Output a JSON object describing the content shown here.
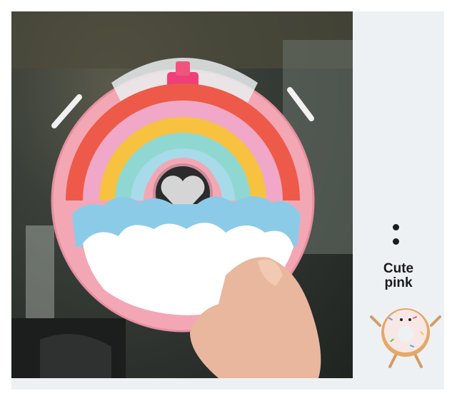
{
  "side_panel": {
    "label_line1": "Cute",
    "label_line2": "pink",
    "icon": "donut-mascot-icon"
  },
  "colors": {
    "bottle_pink": "#f3a7b4",
    "rainbow": [
      "#ee5a4a",
      "#f7c240",
      "#f0a7c8",
      "#8fd8d2",
      "#a7dbe9"
    ],
    "cloud_blue": "#8ccbe8",
    "background": "#eef1f4"
  }
}
